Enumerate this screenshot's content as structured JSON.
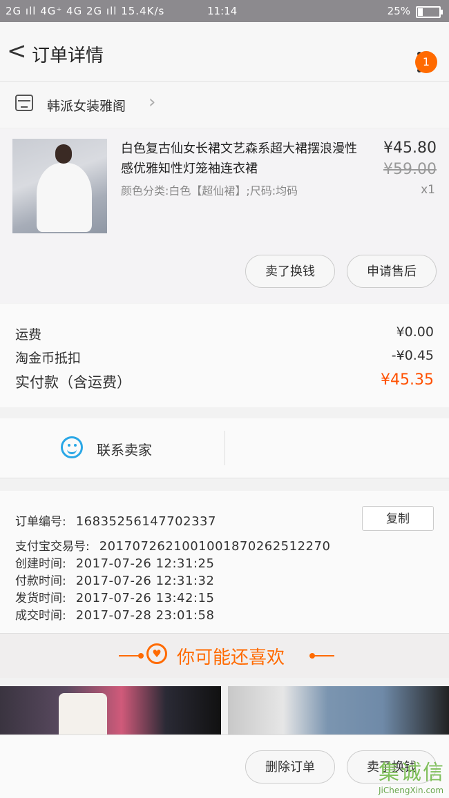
{
  "status": {
    "signal": "2G ıll 4G⁺ 4G 2G ıll",
    "speed": "15.4K/s",
    "time": "11:14",
    "battery": "25%",
    "battery_level": 0.25
  },
  "header": {
    "back": "<",
    "title": "订单详情",
    "badge": "1"
  },
  "shop": {
    "name": "韩派女装雅阁",
    "chevron": "›"
  },
  "item": {
    "title": "白色复古仙女长裙文艺森系超大裙摆浪漫性感优雅知性灯笼袖连衣裙",
    "spec": "颜色分类:白色【超仙裙】;尺码:均码",
    "price": "¥45.80",
    "original_price": "¥59.00",
    "qty": "x1",
    "actions": [
      "卖了换钱",
      "申请售后"
    ]
  },
  "fees": {
    "shipping": {
      "label": "运费",
      "value": "¥0.00"
    },
    "coin": {
      "label": "淘金币抵扣",
      "value": "-¥0.45"
    },
    "total": {
      "label": "实付款（含运费）",
      "value": "¥45.35"
    }
  },
  "contact": {
    "label": "联系卖家"
  },
  "order": {
    "number": {
      "label": "订单编号:",
      "value": "1683525614770233​7"
    },
    "alipay": {
      "label": "支付宝交易号:",
      "value": "2017072621001001870262512270"
    },
    "created": {
      "label": "创建时间:",
      "value": "2017-07-26  12:31:25"
    },
    "paid": {
      "label": "付款时间:",
      "value": "2017-07-26  12:31:32"
    },
    "shipped": {
      "label": "发货时间:",
      "value": "2017-07-26  13:42:15"
    },
    "completed": {
      "label": "成交时间:",
      "value": "2017-07-28  23:01:58"
    },
    "copy": "复制"
  },
  "recommend": {
    "title": "你可能还喜欢",
    "heart": "♥"
  },
  "bottom": {
    "actions": [
      "删除订单",
      "卖了换钱"
    ]
  },
  "watermark": {
    "logo": "集诚信",
    "url": "JiChengXin.com"
  },
  "colors": {
    "accent": "#ff6a00",
    "price_total": "#ff5000",
    "contact_icon": "#2aa7e6"
  }
}
